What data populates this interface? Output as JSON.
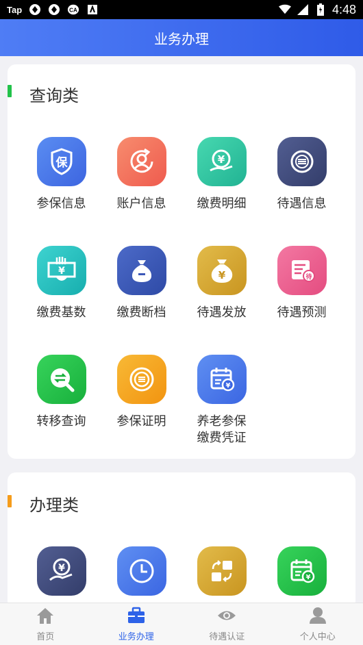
{
  "status_bar": {
    "carrier_badge": "Tap",
    "time": "4:48"
  },
  "header": {
    "title": "业务办理"
  },
  "query_section": {
    "title": "查询类",
    "items": [
      {
        "label": "参保信息",
        "icon": "insurance-shield-icon",
        "color": "#4a78e8"
      },
      {
        "label": "账户信息",
        "icon": "account-person-icon",
        "color": "#f46f5a"
      },
      {
        "label": "缴费明细",
        "icon": "payment-hand-yuan-icon",
        "color": "#2ec6a0"
      },
      {
        "label": "待遇信息",
        "icon": "treatment-coin-icon",
        "color": "#3f4a7a"
      },
      {
        "label": "缴费基数",
        "icon": "payment-base-card-icon",
        "color": "#23bdb8"
      },
      {
        "label": "缴费断档",
        "icon": "money-bag-minus-icon",
        "color": "#3c58b8"
      },
      {
        "label": "待遇发放",
        "icon": "money-bag-yuan-icon",
        "color": "#d8a92e"
      },
      {
        "label": "待遇预测",
        "icon": "forecast-list-icon",
        "color": "#ec5a8c"
      },
      {
        "label": "转移查询",
        "icon": "transfer-search-icon",
        "color": "#22c24a"
      },
      {
        "label": "参保证明",
        "icon": "certificate-coin-icon",
        "color": "#f5a61c"
      },
      {
        "label": "养老参保\n缴费凭证",
        "label_line1": "养老参保",
        "label_line2": "缴费凭证",
        "icon": "pension-voucher-calendar-icon",
        "color": "#4a78e8"
      }
    ]
  },
  "handle_section": {
    "title": "办理类",
    "items": [
      {
        "icon": "yuan-hand-icon",
        "color": "#3f4a7a"
      },
      {
        "icon": "clock-icon",
        "color": "#4a78e8"
      },
      {
        "icon": "exchange-blocks-icon",
        "color": "#d8a92e"
      },
      {
        "icon": "calendar-yuan-icon",
        "color": "#22c24a"
      }
    ]
  },
  "tabbar": {
    "tabs": [
      {
        "label": "首页",
        "icon": "home-icon",
        "active": false
      },
      {
        "label": "业务办理",
        "icon": "briefcase-icon",
        "active": true
      },
      {
        "label": "待遇认证",
        "icon": "eye-icon",
        "active": false
      },
      {
        "label": "个人中心",
        "icon": "person-icon",
        "active": false
      }
    ]
  }
}
